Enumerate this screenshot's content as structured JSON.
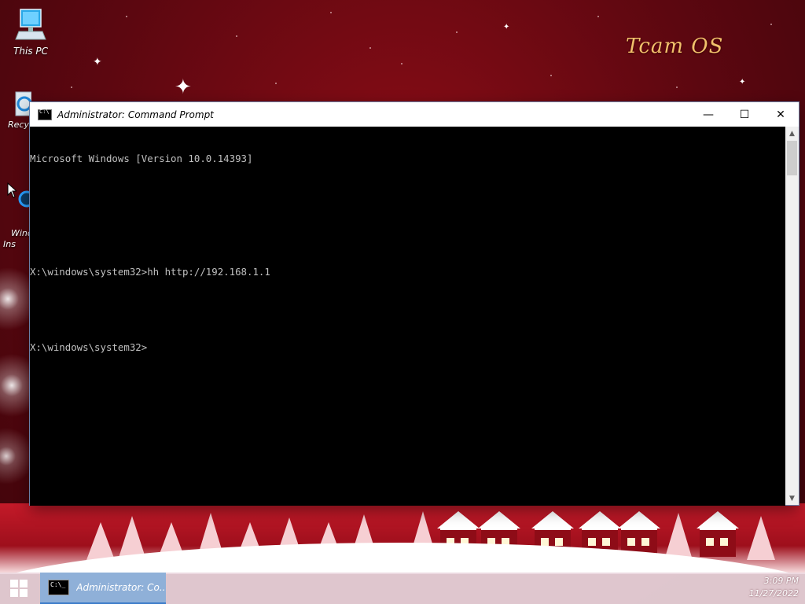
{
  "desktop": {
    "brand": "Tcam OS",
    "icons": [
      {
        "label": "This PC",
        "icon": "computer-icon"
      },
      {
        "label": "Recyc",
        "icon": "recycle-bin-icon"
      },
      {
        "label": "Wind\nIns",
        "icon": "installer-icon"
      }
    ]
  },
  "window": {
    "title": "Administrator: Command Prompt",
    "minimize_symbol": "—",
    "maximize_symbol": "☐",
    "close_symbol": "✕",
    "console_lines": [
      "Microsoft Windows [Version 10.0.14393]",
      "",
      "",
      "X:\\windows\\system32>hh http://192.168.1.1",
      "",
      "X:\\windows\\system32>"
    ],
    "colors": {
      "background": "#000000",
      "text": "#c0c0c0"
    }
  },
  "taskbar": {
    "task_label": "Administrator: Co...",
    "clock_time": "3:09 PM",
    "clock_date": "11/27/2022"
  }
}
